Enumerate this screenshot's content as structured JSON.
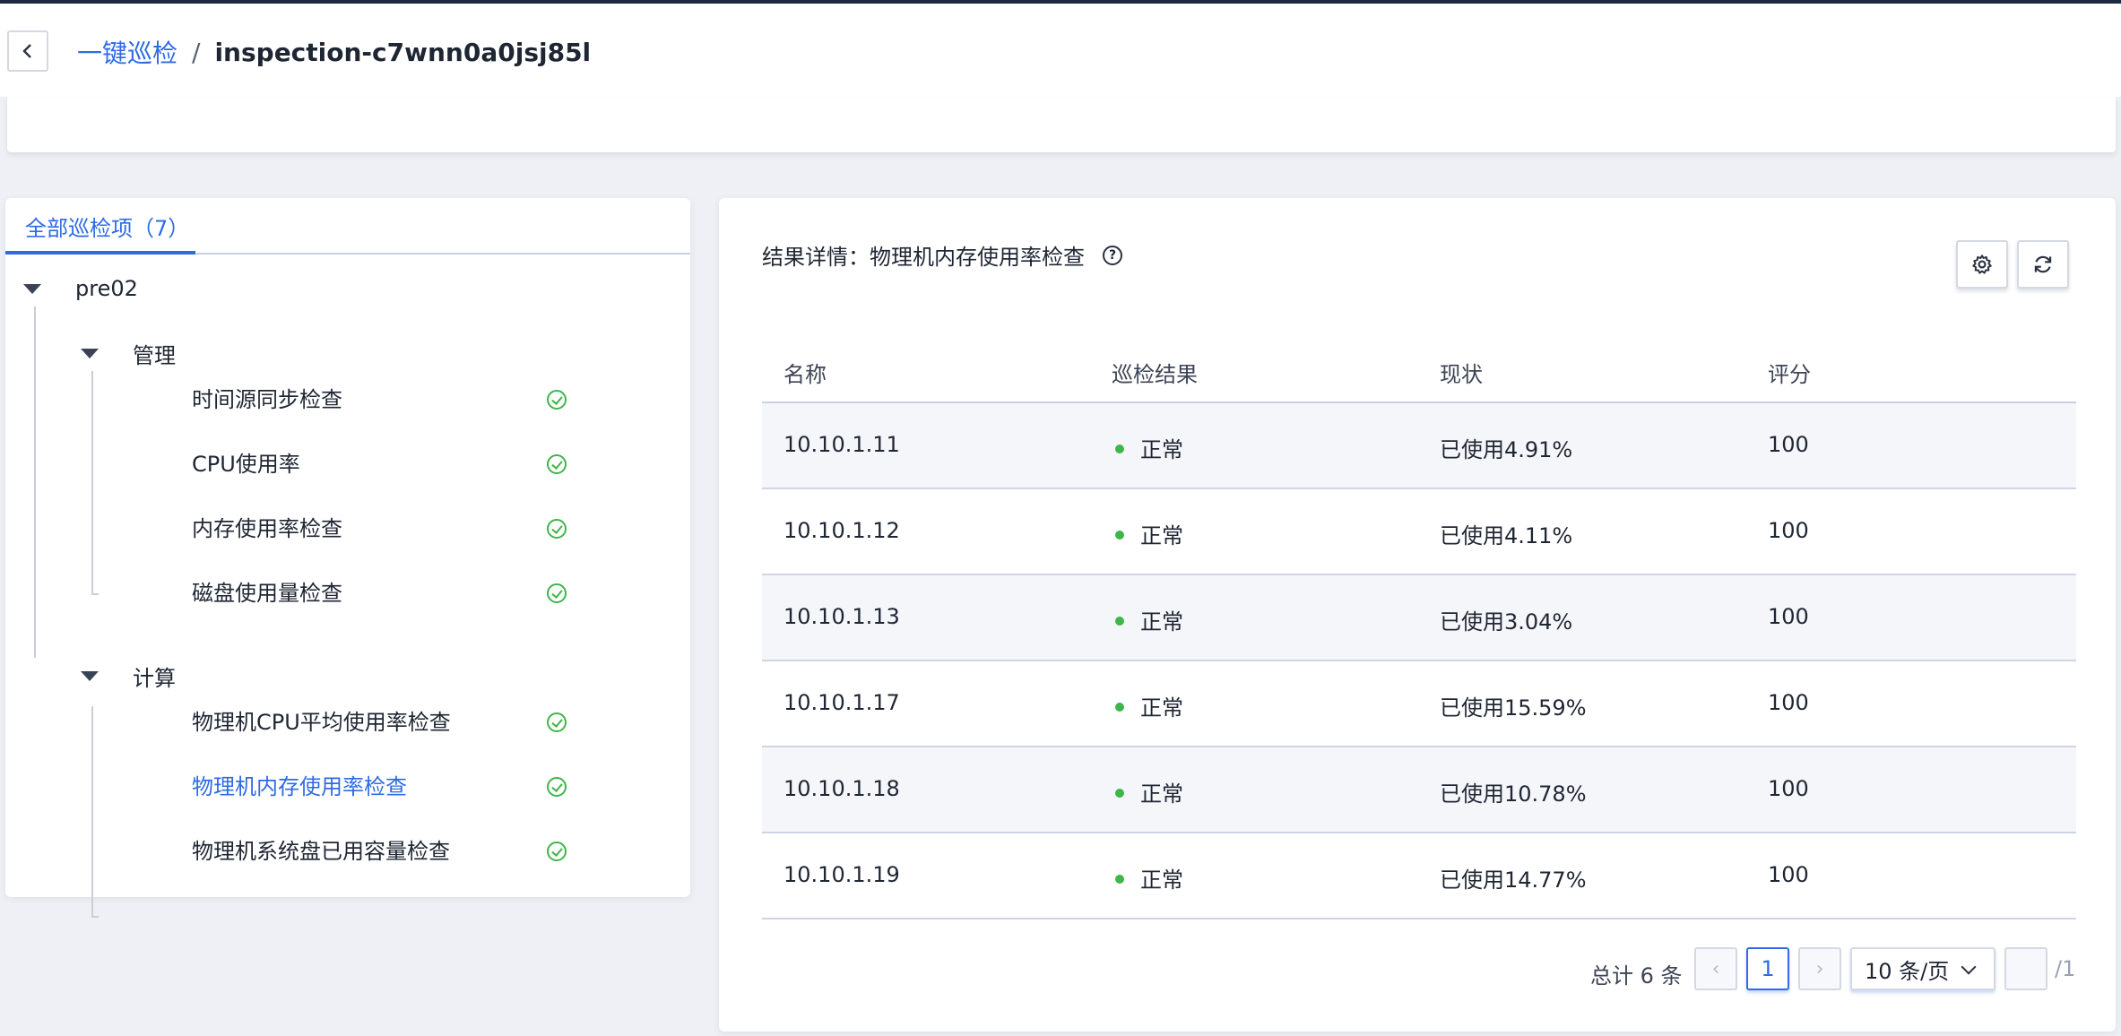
{
  "header": {
    "breadcrumb_link": "一键巡检",
    "breadcrumb_sep": "/",
    "breadcrumb_current": "inspection-c7wnn0a0jsj85l"
  },
  "left": {
    "tab_label": "全部巡检项（7）",
    "tree": {
      "root": "pre02",
      "groups": [
        {
          "label": "管理",
          "items": [
            "时间源同步检查",
            "CPU使用率",
            "内存使用率检查",
            "磁盘使用量检查"
          ]
        },
        {
          "label": "计算",
          "items": [
            "物理机CPU平均使用率检查",
            "物理机内存使用率检查",
            "物理机系统盘已用容量检查"
          ]
        }
      ],
      "active_item": "物理机内存使用率检查"
    }
  },
  "right": {
    "result_title": "结果详情：物理机内存使用率检查",
    "help_icon": "?",
    "columns": [
      "名称",
      "巡检结果",
      "现状",
      "评分"
    ],
    "rows": [
      {
        "name": "10.10.1.11",
        "result": "正常",
        "status": "已使用4.91%",
        "score": "100"
      },
      {
        "name": "10.10.1.12",
        "result": "正常",
        "status": "已使用4.11%",
        "score": "100"
      },
      {
        "name": "10.10.1.13",
        "result": "正常",
        "status": "已使用3.04%",
        "score": "100"
      },
      {
        "name": "10.10.1.17",
        "result": "正常",
        "status": "已使用15.59%",
        "score": "100"
      },
      {
        "name": "10.10.1.18",
        "result": "正常",
        "status": "已使用10.78%",
        "score": "100"
      },
      {
        "name": "10.10.1.19",
        "result": "正常",
        "status": "已使用14.77%",
        "score": "100"
      }
    ],
    "pagination": {
      "total_text": "总计 6 条",
      "current_page": "1",
      "page_size": "10 条/页",
      "page_total": "/1",
      "prev": "‹",
      "next": "›"
    }
  },
  "colors": {
    "accent": "#2e6be6",
    "success": "#3fb54a",
    "topbar": "#1e2a44"
  }
}
